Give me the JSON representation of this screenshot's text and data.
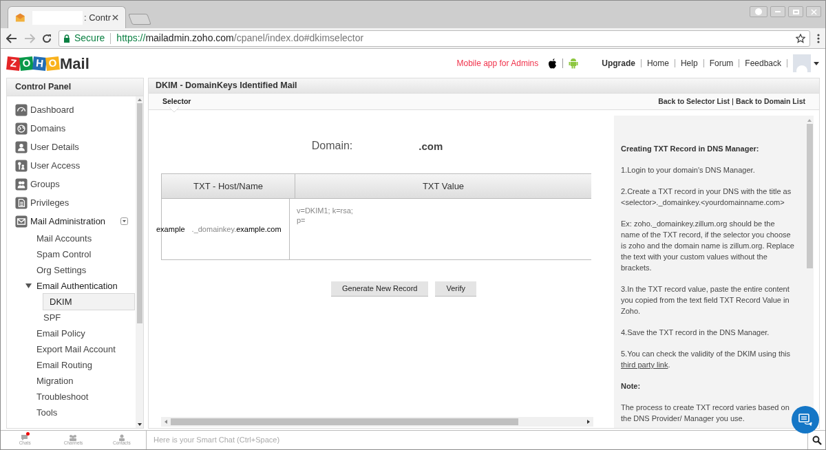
{
  "browser": {
    "tab_title": ": Contr",
    "secure_label": "Secure",
    "url_scheme": "https://",
    "url_host": "mailadmin.zoho.com",
    "url_path": "/cpanel/index.do#dkimselector"
  },
  "header": {
    "logo_letters": [
      "Z",
      "O",
      "H",
      "O"
    ],
    "logo_word": "Mail",
    "mobile_label": "Mobile app for Admins",
    "nav_links": [
      "Upgrade",
      "Home",
      "Help",
      "Forum",
      "Feedback"
    ]
  },
  "sidebar": {
    "title": "Control Panel",
    "items": [
      {
        "label": "Dashboard",
        "selected": false
      },
      {
        "label": "Domains",
        "selected": false
      },
      {
        "label": "User Details",
        "selected": false
      },
      {
        "label": "User Access",
        "selected": false
      },
      {
        "label": "Groups",
        "selected": false
      },
      {
        "label": "Privileges",
        "selected": false
      },
      {
        "label": "Mail Administration",
        "expanded": true,
        "selected": false,
        "children": [
          {
            "label": "Mail Accounts",
            "selected": false
          },
          {
            "label": "Spam Control",
            "selected": false
          },
          {
            "label": "Org Settings",
            "selected": false
          },
          {
            "label": "Email Authentication",
            "expanded": true,
            "selected": false,
            "children": [
              {
                "label": "DKIM",
                "selected": true
              },
              {
                "label": "SPF",
                "selected": false
              }
            ]
          },
          {
            "label": "Email Policy",
            "selected": false
          },
          {
            "label": "Export Mail Account",
            "selected": false
          },
          {
            "label": "Email Routing",
            "selected": false
          },
          {
            "label": "Migration",
            "selected": false
          },
          {
            "label": "Troubleshoot",
            "selected": false
          },
          {
            "label": "Tools",
            "selected": false
          }
        ]
      }
    ]
  },
  "content": {
    "title": "DKIM - DomainKeys Identified Mail",
    "tabs": [
      {
        "label": "Selector",
        "selected": true
      }
    ],
    "back_links": [
      "Back to Selector List",
      "Back to Domain List"
    ],
    "domain_label": "Domain:",
    "domain_value": ".com",
    "table": {
      "columns": [
        "TXT - Host/Name",
        "TXT Value"
      ],
      "host": {
        "selector": "example",
        "middle": "._domainkey.",
        "domain": "example.com"
      },
      "value_lines": [
        "v=DKIM1; k=rsa;",
        "p="
      ]
    },
    "buttons": [
      "Generate New Record",
      "Verify"
    ],
    "help": [
      {
        "kind": "heading",
        "text": "Creating TXT Record in DNS Manager:"
      },
      {
        "kind": "text",
        "text": "1.Login to your domain's DNS Manager."
      },
      {
        "kind": "text",
        "text": "2.Create a TXT record in your DNS with the title as <selector>._domainkey.<yourdomainname.com>"
      },
      {
        "kind": "text",
        "text": "Ex: zoho._domainkey.zillum.org should be the name of the TXT record, if the selector you choose is zoho and the domain name is zillum.org. Replace the text with your custom values without the brackets."
      },
      {
        "kind": "text",
        "text": "3.In the TXT record value, paste the entire content you copied from the text field TXT Record Value in Zoho."
      },
      {
        "kind": "text",
        "text": "4.Save the TXT record in the DNS Manager."
      },
      {
        "kind": "link",
        "text": "5.You can check the validity of the DKIM using this",
        "link": "third party link",
        "after": "."
      },
      {
        "kind": "heading",
        "text": "Note:"
      },
      {
        "kind": "text",
        "text": "The process to create TXT record varies based on the DNS Provider/ Manager you use."
      }
    ]
  },
  "bottom_bar": {
    "tabs": [
      "Chats",
      "Channels",
      "Contacts"
    ],
    "chat_placeholder": "Here is your Smart Chat (Ctrl+Space)"
  }
}
